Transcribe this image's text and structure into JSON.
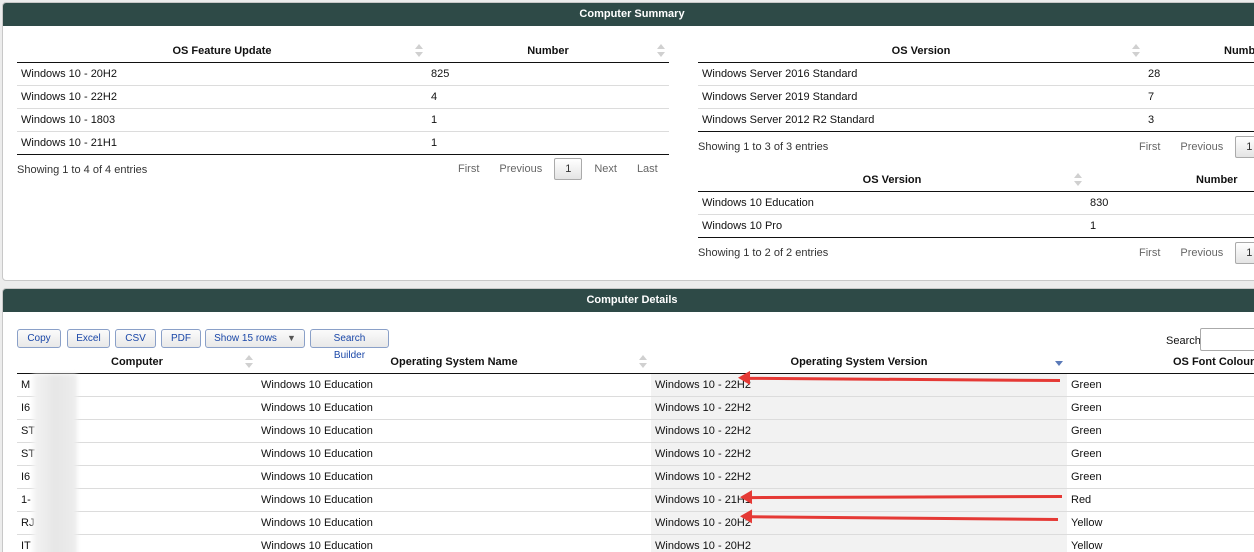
{
  "summary": {
    "title": "Computer Summary",
    "feature_table": {
      "columns": [
        "OS Feature Update",
        "Number"
      ],
      "rows": [
        [
          "Windows 10 - 20H2",
          "825"
        ],
        [
          "Windows 10 - 22H2",
          "4"
        ],
        [
          "Windows 10 - 1803",
          "1"
        ],
        [
          "Windows 10 - 21H1",
          "1"
        ]
      ],
      "info": "Showing 1 to 4 of 4 entries",
      "pager": {
        "first": "First",
        "previous": "Previous",
        "current": "1",
        "next": "Next",
        "last": "Last"
      }
    },
    "server_table": {
      "columns": [
        "OS Version",
        "Numb"
      ],
      "rows": [
        [
          "Windows Server 2016 Standard",
          "28"
        ],
        [
          "Windows Server 2019 Standard",
          "7"
        ],
        [
          "Windows Server 2012 R2 Standard",
          "3"
        ]
      ],
      "info": "Showing 1 to 3 of 3 entries",
      "pager": {
        "first": "First",
        "previous": "Previous",
        "current": "1"
      }
    },
    "win_table": {
      "columns": [
        "OS Version",
        "Number"
      ],
      "rows": [
        [
          "Windows 10 Education",
          "830"
        ],
        [
          "Windows 10 Pro",
          "1"
        ]
      ],
      "info": "Showing 1 to 2 of 2 entries",
      "pager": {
        "first": "First",
        "previous": "Previous",
        "current": "1"
      }
    }
  },
  "details": {
    "title": "Computer Details",
    "buttons": {
      "copy": "Copy",
      "excel": "Excel",
      "csv": "CSV",
      "pdf": "PDF",
      "show_rows": "Show 15 rows",
      "search_builder": "Search Builder"
    },
    "search_label": "Search:",
    "columns": [
      "Computer",
      "Operating System Name",
      "Operating System Version",
      "OS Font Colour"
    ],
    "rows": [
      [
        "M",
        "Windows 10 Education",
        "Windows 10 - 22H2",
        "Green"
      ],
      [
        "I6",
        "Windows 10 Education",
        "Windows 10 - 22H2",
        "Green"
      ],
      [
        "ST              2",
        "Windows 10 Education",
        "Windows 10 - 22H2",
        "Green"
      ],
      [
        "ST              E-01",
        "Windows 10 Education",
        "Windows 10 - 22H2",
        "Green"
      ],
      [
        "I6",
        "Windows 10 Education",
        "Windows 10 - 22H2",
        "Green"
      ],
      [
        "1-",
        "Windows 10 Education",
        "Windows 10 - 21H1",
        "Red"
      ],
      [
        "RJ              P",
        "Windows 10 Education",
        "Windows 10 - 20H2",
        "Yellow"
      ],
      [
        "IT",
        "Windows 10 Education",
        "Windows 10 - 20H2",
        "Yellow"
      ]
    ]
  },
  "colors": {
    "header_bg": "#2e4a47",
    "annotation_arrow": "#e53935",
    "button_text": "#1a47a8"
  }
}
